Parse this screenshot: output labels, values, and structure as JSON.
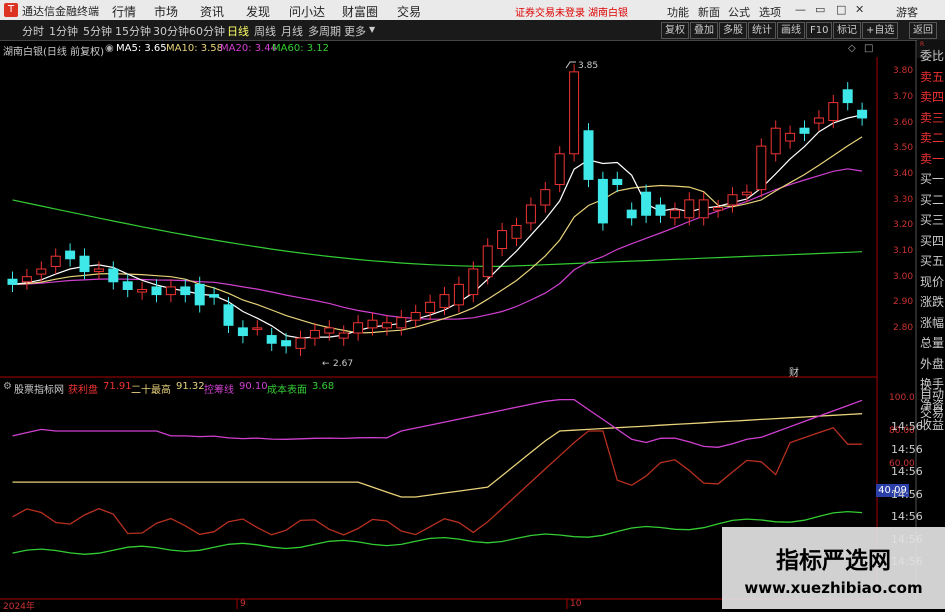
{
  "titlebar": {
    "app_title": "通达信金融终端",
    "menu": [
      "行情",
      "市场",
      "资讯",
      "发现",
      "问小达",
      "财富圈",
      "交易"
    ],
    "warning": "证券交易未登录",
    "stock_name": "湖南白银",
    "right_menu": [
      "功能",
      "新面",
      "公式",
      "选项"
    ],
    "guest": "游客"
  },
  "toolbar": {
    "periods": [
      "分时",
      "1分钟",
      "5分钟",
      "15分钟",
      "30分钟",
      "60分钟",
      "日线",
      "周线",
      "月线",
      "多周期",
      "更多"
    ],
    "active_period": "日线",
    "right_buttons": [
      "复权",
      "叠加",
      "多股",
      "统计",
      "画线",
      "F10",
      "标记",
      "+自选",
      "返回"
    ]
  },
  "main_chart": {
    "title": "湖南白银(日线 前复权)",
    "ma5": "MA5: 3.65",
    "ma10": "MA10: 3.58",
    "ma20": "MA20: 3.44",
    "ma60": "MA60: 3.12",
    "high_label": "3.85",
    "low_label": "2.67",
    "cai_label": "财",
    "yticks": [
      "3.80",
      "3.70",
      "3.60",
      "3.50",
      "3.40",
      "3.30",
      "3.20",
      "3.10",
      "3.00",
      "2.90",
      "2.80"
    ],
    "colors": {
      "up": "#e33",
      "down": "#3ee8e8",
      "ma5": "#ffffff",
      "ma10": "#e8d27a",
      "ma20": "#d040d0",
      "ma60": "#33cc33"
    }
  },
  "chart_data": {
    "type": "candlestick",
    "x": [
      "2024-07-26",
      "2024-07-29",
      "2024-07-30",
      "2024-07-31",
      "2024-08-01",
      "2024-08-02",
      "2024-08-05",
      "2024-08-06",
      "2024-08-07",
      "2024-08-08",
      "2024-08-09",
      "2024-08-12",
      "2024-08-13",
      "2024-08-14",
      "2024-08-15",
      "2024-08-16",
      "2024-08-19",
      "2024-08-20",
      "2024-08-21",
      "2024-08-22",
      "2024-08-23",
      "2024-08-26",
      "2024-08-27",
      "2024-08-28",
      "2024-08-29",
      "2024-08-30",
      "2024-09-02",
      "2024-09-03",
      "2024-09-04",
      "2024-09-05",
      "2024-09-06",
      "2024-09-09",
      "2024-09-10",
      "2024-09-11",
      "2024-09-12",
      "2024-09-13",
      "2024-09-18",
      "2024-09-19",
      "2024-09-20",
      "2024-09-23",
      "2024-09-24",
      "2024-09-25",
      "2024-09-26",
      "2024-09-27",
      "2024-09-30",
      "2024-10-08",
      "2024-10-09",
      "2024-10-10",
      "2024-10-11",
      "2024-10-14",
      "2024-10-15",
      "2024-10-16",
      "2024-10-17",
      "2024-10-18",
      "2024-10-21",
      "2024-10-22",
      "2024-10-23",
      "2024-10-24",
      "2024-10-25",
      "2024-10-28"
    ],
    "open": [
      3.01,
      3.0,
      3.03,
      3.06,
      3.12,
      3.1,
      3.04,
      3.05,
      3.0,
      2.96,
      2.98,
      2.95,
      2.98,
      2.99,
      2.95,
      2.91,
      2.82,
      2.82,
      2.79,
      2.77,
      2.74,
      2.78,
      2.8,
      2.78,
      2.8,
      2.82,
      2.82,
      2.82,
      2.85,
      2.88,
      2.9,
      2.91,
      2.95,
      3.02,
      3.13,
      3.17,
      3.23,
      3.3,
      3.38,
      3.5,
      3.59,
      3.4,
      3.4,
      3.28,
      3.35,
      3.3,
      3.25,
      3.25,
      3.25,
      3.28,
      3.3,
      3.34,
      3.36,
      3.5,
      3.55,
      3.6,
      3.62,
      3.63,
      3.75,
      3.67
    ],
    "close": [
      2.99,
      3.02,
      3.05,
      3.1,
      3.09,
      3.04,
      3.05,
      3.0,
      2.97,
      2.97,
      2.95,
      2.98,
      2.95,
      2.91,
      2.94,
      2.83,
      2.79,
      2.82,
      2.76,
      2.75,
      2.78,
      2.81,
      2.82,
      2.8,
      2.84,
      2.85,
      2.84,
      2.86,
      2.88,
      2.92,
      2.95,
      2.99,
      3.05,
      3.14,
      3.2,
      3.22,
      3.3,
      3.36,
      3.5,
      3.82,
      3.4,
      3.23,
      3.38,
      3.25,
      3.26,
      3.26,
      3.28,
      3.32,
      3.32,
      3.29,
      3.34,
      3.35,
      3.53,
      3.6,
      3.58,
      3.58,
      3.64,
      3.7,
      3.7,
      3.64
    ]
  },
  "indicator": {
    "name": "股票指标网",
    "items": [
      {
        "label": "获利盘",
        "value": "71.91",
        "color": "#e33"
      },
      {
        "label": "二十最高",
        "value": "91.32",
        "color": "#e8d27a"
      },
      {
        "label": "控筹线",
        "value": "90.10",
        "color": "#d040d0"
      },
      {
        "label": "成本表面",
        "value": "3.68",
        "color": "#33cc33"
      }
    ],
    "yticks": [
      "100.0",
      "80.00",
      "60.00"
    ],
    "cursor_value": "40.09"
  },
  "sidebar": {
    "labels": [
      "委比",
      "卖五",
      "卖四",
      "卖三",
      "卖二",
      "卖一",
      "买一",
      "买二",
      "买三",
      "买四",
      "买五",
      "现价",
      "涨跌",
      "涨幅",
      "总量",
      "外盘",
      "换手",
      "净资",
      "收益",
      "自动",
      "交易"
    ],
    "time_values": [
      "14:56",
      "14:56",
      "14:56",
      "14:56",
      "14:56",
      "14:56",
      "14:56"
    ]
  },
  "date_axis": {
    "labels": [
      "2024年",
      "9",
      "10"
    ]
  },
  "watermark": {
    "title": "指标严选网",
    "url": "www.xuezhibiao.com"
  }
}
